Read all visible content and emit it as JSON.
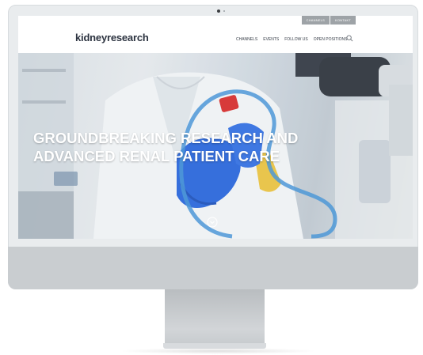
{
  "site": {
    "logo": "kidneyresearch",
    "utility_links": [
      "CHANNELS",
      "KONTAKT"
    ],
    "nav_items": [
      "CHANNELS",
      "EVENTS",
      "FOLLOW US",
      "OPEN POSITIONS"
    ],
    "search_icon": "search-icon"
  },
  "hero": {
    "headline_line1": "GROUNDBREAKING RESEARCH AND",
    "headline_line2": "ADVANCED RENAL PATIENT CARE",
    "scroll_icon": "chevron-down-icon"
  },
  "colors": {
    "logo": "#2c3340",
    "kidney_outline": "#3f8fd4",
    "glove": "#2563d9",
    "utility_bar": "#9ea3a7"
  }
}
